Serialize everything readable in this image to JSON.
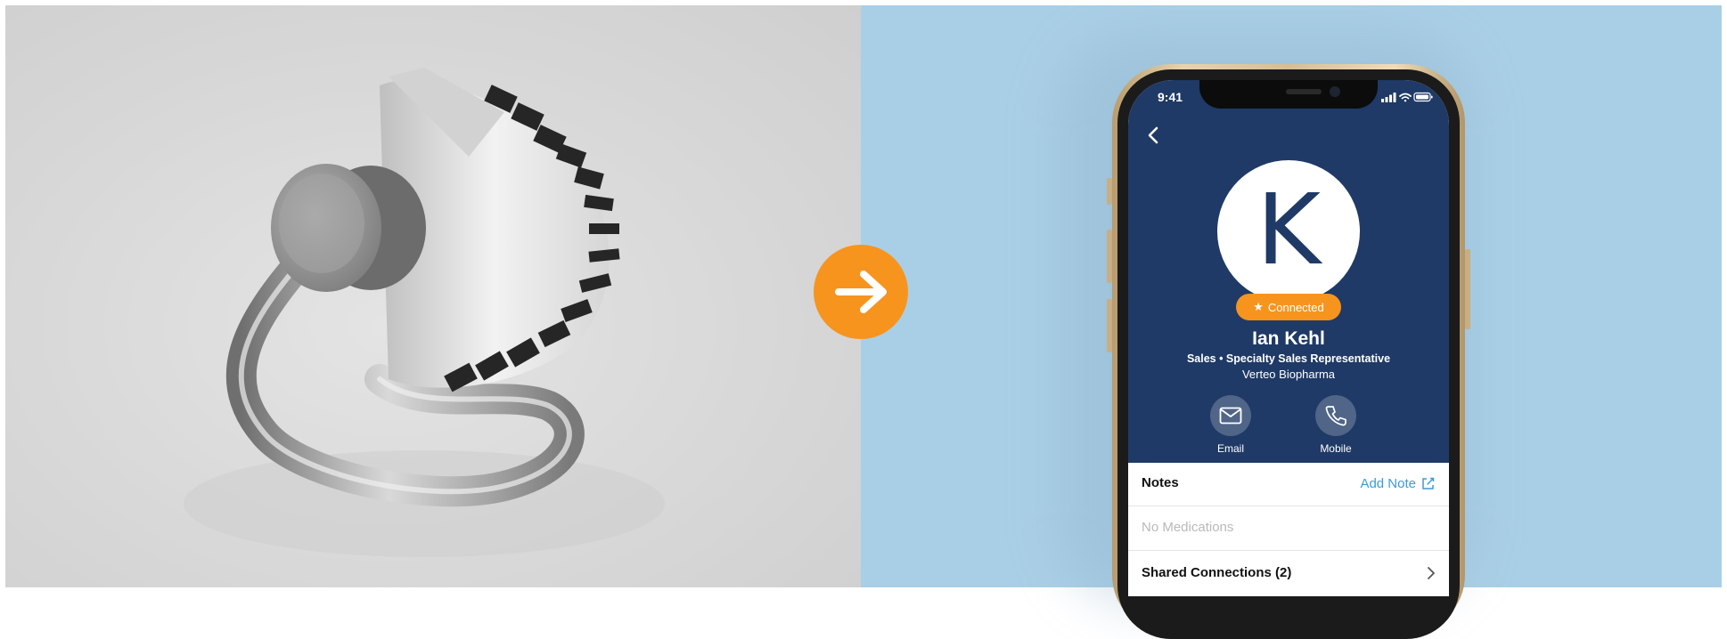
{
  "phone": {
    "status_time": "9:41",
    "avatar_letter": "K",
    "badge_label": "Connected",
    "name": "Ian Kehl",
    "title_line": "Sales • Specialty Sales Representative",
    "company": "Verteo Biopharma",
    "actions": [
      {
        "label": "Email",
        "icon": "envelope-icon"
      },
      {
        "label": "Mobile",
        "icon": "phone-icon"
      }
    ],
    "notes": {
      "title": "Notes",
      "add_label": "Add Note"
    },
    "medications": {
      "label": "No Medications"
    },
    "shared": {
      "title": "Shared Connections (2)"
    }
  },
  "colors": {
    "accent_orange": "#f7941e",
    "profile_navy": "#1f3a66",
    "link_blue": "#3d9ad8",
    "background_blue": "#a9cfe6"
  }
}
